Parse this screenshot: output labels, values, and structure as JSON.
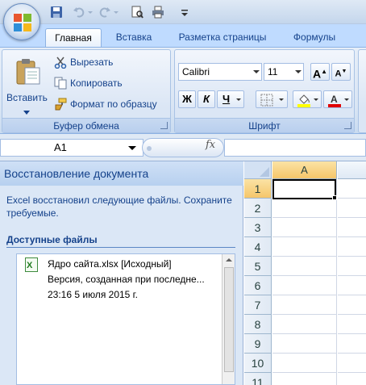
{
  "ribbon_tabs": [
    "Главная",
    "Вставка",
    "Разметка страницы",
    "Формулы"
  ],
  "clipboard": {
    "paste_label": "Вставить",
    "cut_label": "Вырезать",
    "copy_label": "Копировать",
    "format_painter_label": "Формат по образцу",
    "group_label": "Буфер обмена"
  },
  "font": {
    "name": "Calibri",
    "size": "11",
    "bold": "Ж",
    "italic": "К",
    "underline": "Ч",
    "grow": "A",
    "shrink": "A",
    "group_label": "Шрифт"
  },
  "formula_bar": {
    "name_box": "A1",
    "fx": "fx",
    "formula": ""
  },
  "recovery": {
    "title": "Восстановление документа",
    "message": "Excel восстановил следующие файлы. Сохраните требуемые.",
    "files_heading": "Доступные файлы",
    "file": {
      "name_line": "Ядро сайта.xlsx  [Исходный]",
      "version_line": "Версия, созданная при последне...",
      "time_line": "23:16 5 июля 2015 г."
    }
  },
  "sheet": {
    "columns": [
      "A"
    ],
    "rows": [
      "1",
      "2",
      "3",
      "4",
      "5",
      "6",
      "7",
      "8",
      "9",
      "10",
      "11"
    ],
    "active_cell": "A1"
  },
  "colors": {
    "accent": "#15428b",
    "tab_bar": "#bfdbff",
    "ribbon": "#dbe6f5",
    "highlight": "#ffff00",
    "font_color": "#e00000",
    "excel_green": "#1f7a1f"
  }
}
